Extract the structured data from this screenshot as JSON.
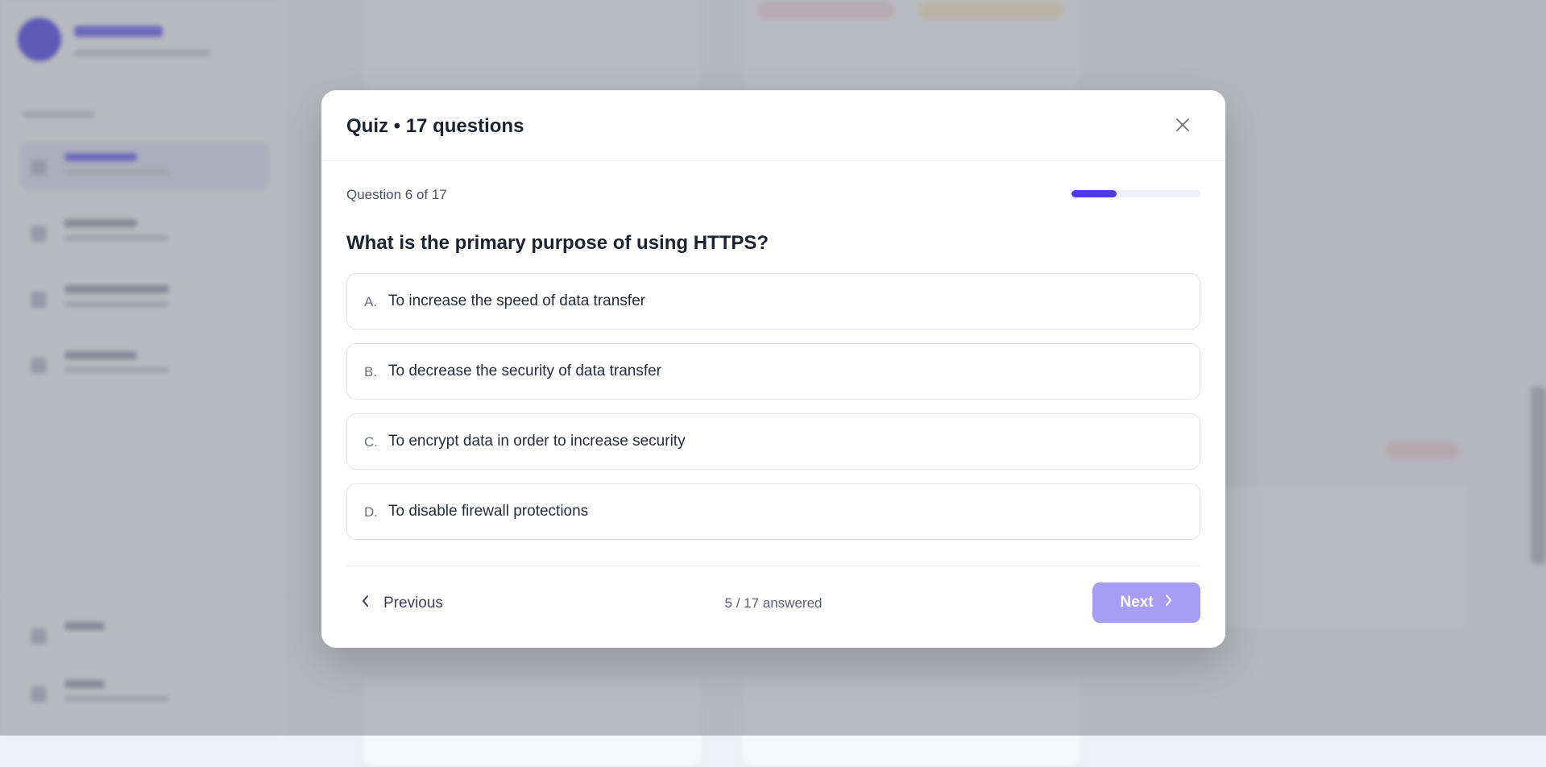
{
  "modal": {
    "title": "Quiz • 17 questions",
    "close_icon": "close-icon",
    "progress": {
      "label": "Question 6 of 17",
      "fraction": 0.35,
      "color": "#4f3ae6"
    },
    "question": "What is the primary purpose of using HTTPS?",
    "options": [
      {
        "letter": "A.",
        "text": "To increase the speed of data transfer"
      },
      {
        "letter": "B.",
        "text": "To decrease the security of data transfer"
      },
      {
        "letter": "C.",
        "text": "To encrypt data in order to increase security"
      },
      {
        "letter": "D.",
        "text": "To disable firewall protections"
      }
    ],
    "footer": {
      "previous_label": "Previous",
      "previous_icon": "chevron-left-icon",
      "answered_status": "5 / 17 answered",
      "next_label": "Next",
      "next_icon": "chevron-right-icon",
      "next_color": "#a79cf6"
    }
  }
}
